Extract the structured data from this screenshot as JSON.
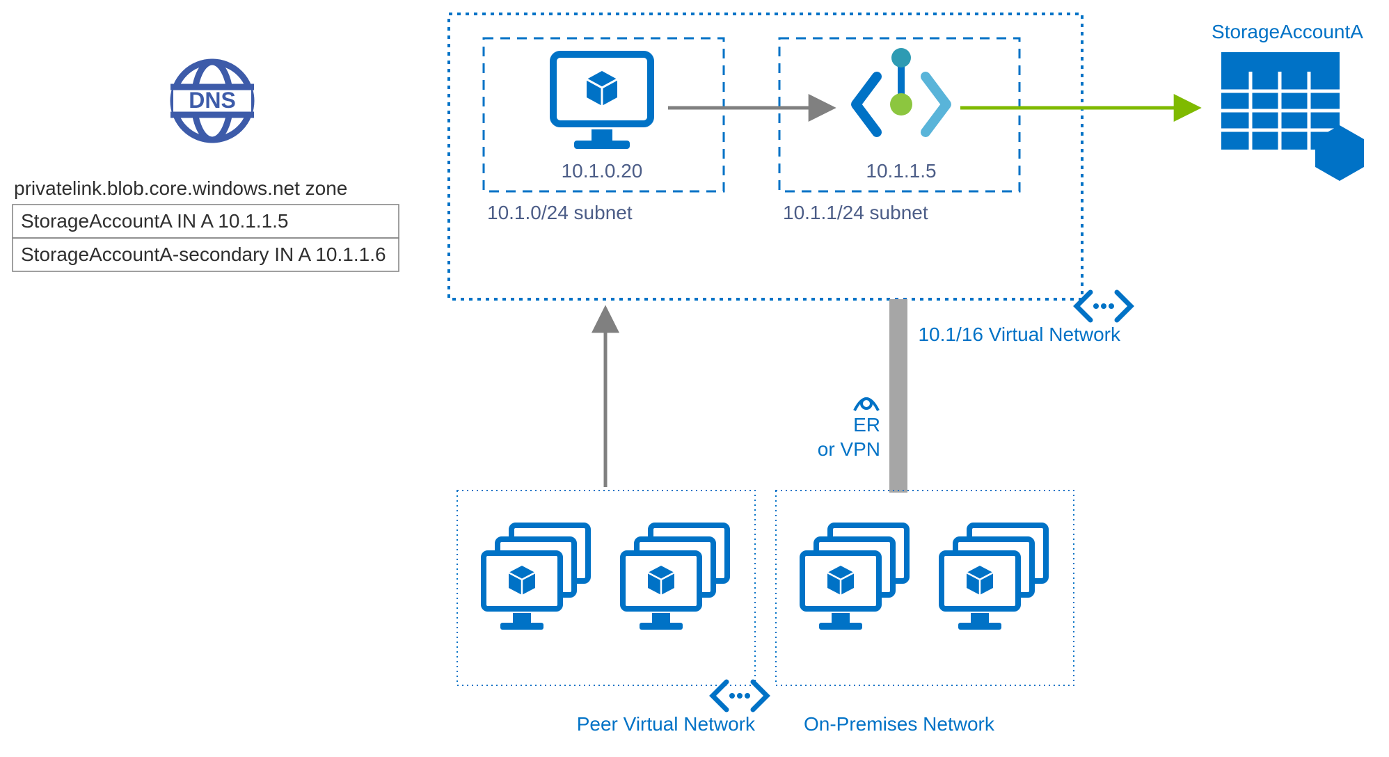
{
  "dns": {
    "zone_label": "privatelink.blob.core.windows.net zone",
    "records": [
      "StorageAccountA IN A 10.1.1.5",
      "StorageAccountA-secondary IN A 10.1.1.6"
    ]
  },
  "vnet": {
    "cidr_label": "10.1/16 Virtual Network",
    "subnet_a": {
      "label": "10.1.0/24 subnet",
      "vm_ip": "10.1.0.20"
    },
    "subnet_b": {
      "label": "10.1.1/24 subnet",
      "pe_ip": "10.1.1.5"
    }
  },
  "connection": {
    "er_vpn_line1": "ER",
    "er_vpn_line2": "or VPN"
  },
  "peer_network": {
    "label": "Peer Virtual Network"
  },
  "onprem_network": {
    "label": "On-Premises Network"
  },
  "storage": {
    "label": "StorageAccountA"
  },
  "colors": {
    "azure_blue": "#0072C6",
    "label_slate": "#4c5d87",
    "arrow_gray": "#808080",
    "arrow_green": "#7FBA00",
    "thick_gray": "#A6A6A6",
    "green_dot": "#8CC63F",
    "teal_dot": "#2E9BB3"
  }
}
